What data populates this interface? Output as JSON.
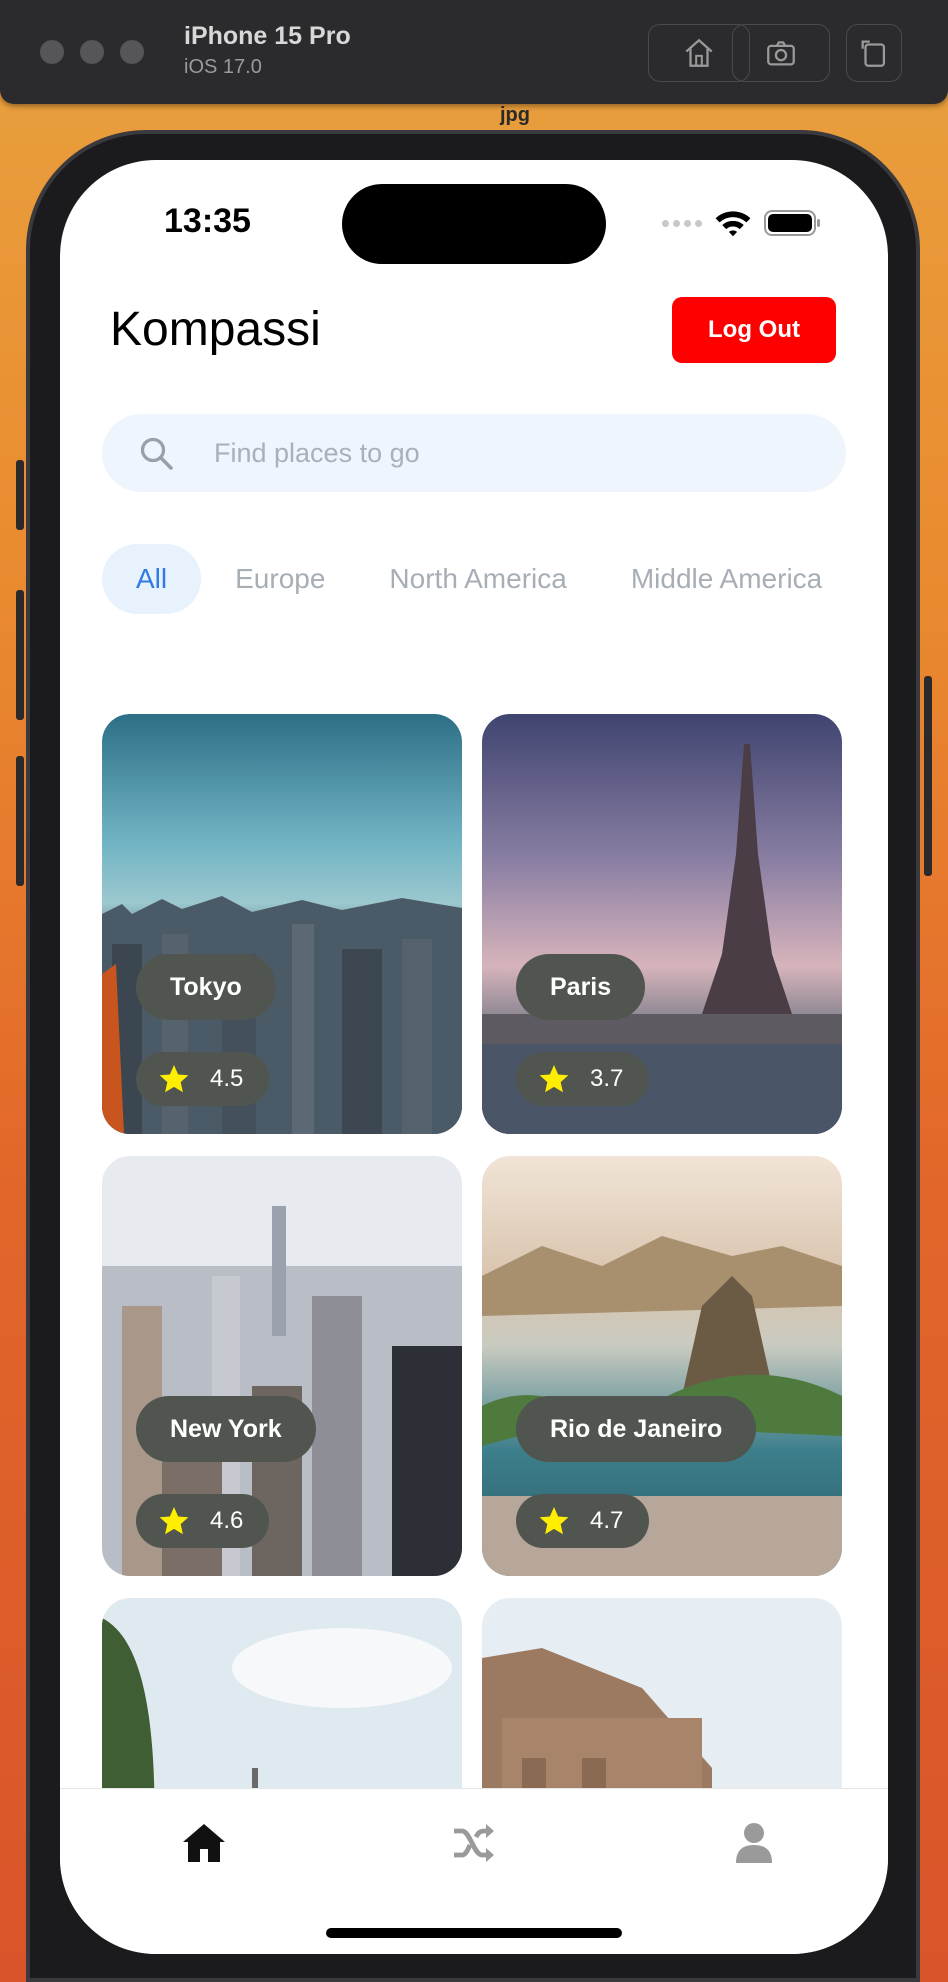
{
  "simulator": {
    "device": "iPhone 15 Pro",
    "os": "iOS 17.0",
    "background_label": "jpg"
  },
  "status_bar": {
    "time": "13:35"
  },
  "header": {
    "title": "Kompassi",
    "logout_label": "Log Out"
  },
  "search": {
    "placeholder": "Find places to go",
    "value": ""
  },
  "categories": [
    {
      "label": "All",
      "active": true
    },
    {
      "label": "Europe",
      "active": false
    },
    {
      "label": "North America",
      "active": false
    },
    {
      "label": "Middle America",
      "active": false
    }
  ],
  "places": [
    {
      "name": "Tokyo",
      "rating": "4.5"
    },
    {
      "name": "Paris",
      "rating": "3.7"
    },
    {
      "name": "New York",
      "rating": "4.6"
    },
    {
      "name": "Rio de Janeiro",
      "rating": "4.7"
    }
  ],
  "tabs": [
    {
      "icon": "home-icon",
      "active": true
    },
    {
      "icon": "shuffle-icon",
      "active": false
    },
    {
      "icon": "person-icon",
      "active": false
    }
  ],
  "colors": {
    "logout": "#ff0000",
    "active_category_text": "#2f7ae5",
    "active_category_bg": "#e8f2fd",
    "pill_bg": "#505550",
    "star": "#ffee00"
  }
}
